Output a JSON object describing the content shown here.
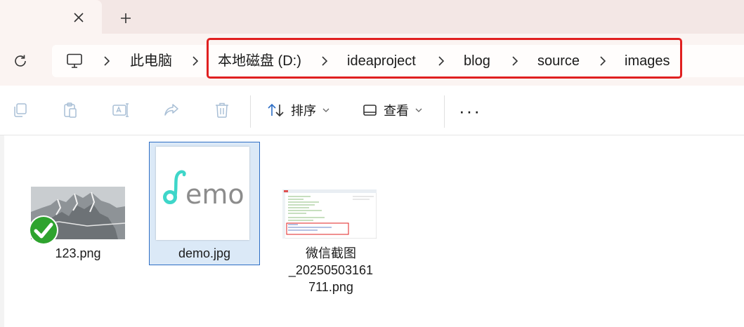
{
  "tabs": {
    "close_label": "✕",
    "new_tab_label": "+"
  },
  "address": {
    "crumbs": [
      "此电脑",
      "本地磁盘 (D:)",
      "ideaproject",
      "blog",
      "source",
      "images"
    ],
    "separator": "›"
  },
  "toolbar": {
    "sort_label": "排序",
    "view_label": "查看",
    "more_label": "···"
  },
  "files": [
    {
      "name": "123.png",
      "status": "synced"
    },
    {
      "name": "demo.jpg",
      "selected": true,
      "thumbnail_text": "demo"
    },
    {
      "name_line1": "微信截图",
      "name_line2": "_20250503161",
      "name_line3": "711.png"
    }
  ],
  "colors": {
    "highlight": "#e02020",
    "selection": "#dbe9f7",
    "selection_border": "#2d6ec5",
    "demo_teal": "#3ed6c9",
    "demo_gray": "#8c8c8c",
    "sync_green": "#2ea32e"
  },
  "icons": [
    "computer-icon",
    "refresh-icon",
    "copy-icon",
    "paste-icon",
    "rename-icon",
    "share-icon",
    "delete-icon",
    "sort-icon",
    "view-icon"
  ]
}
